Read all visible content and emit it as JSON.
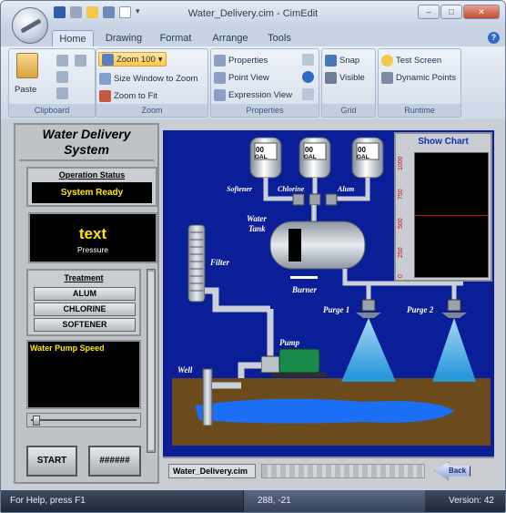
{
  "window": {
    "title": "Water_Delivery.cim - CimEdit",
    "min": "–",
    "max": "□",
    "close": "✕"
  },
  "tabs": [
    "Home",
    "Drawing",
    "Format",
    "Arrange",
    "Tools"
  ],
  "ribbon": {
    "clipboard": {
      "label": "Clipboard",
      "paste": "Paste"
    },
    "zoom": {
      "label": "Zoom",
      "zoom100": "Zoom 100",
      "size_window": "Size Window to Zoom",
      "zoom_fit": "Zoom to Fit"
    },
    "properties": {
      "label": "Properties",
      "properties": "Properties",
      "point_view": "Point View",
      "expression_view": "Expression View"
    },
    "grid": {
      "label": "Grid",
      "snap": "Snap",
      "visible": "Visible"
    },
    "runtime": {
      "label": "Runtime",
      "test_screen": "Test Screen",
      "dynamic_points": "Dynamic Points"
    }
  },
  "panel": {
    "title_line1": "Water Delivery",
    "title_line2": "System",
    "op_status_label": "Operation Status",
    "op_status_value": "System Ready",
    "pressure_value": "text",
    "pressure_label": "Pressure",
    "treatment_label": "Treatment",
    "treatments": [
      "ALUM",
      "CHLORINE",
      "SOFTENER"
    ],
    "pump_speed_label": "Water Pump Speed",
    "start": "START",
    "hash": "######"
  },
  "scene": {
    "tanks": [
      {
        "value": "00",
        "unit": "GAL",
        "label": "Softener"
      },
      {
        "value": "00",
        "unit": "GAL",
        "label": "Chlorine"
      },
      {
        "value": "00",
        "unit": "GAL",
        "label": "Alum"
      }
    ],
    "water_tank": "Water\nTank",
    "filter": "Filter",
    "burner": "Burner",
    "pump": "Pump",
    "well": "Well",
    "purge1": "Purge 1",
    "purge2": "Purge 2",
    "show_chart": "Show Chart",
    "chart_ticks": [
      "1000",
      "750",
      "500",
      "250",
      "0"
    ],
    "footer_file": "Water_Delivery.cim",
    "back": "Back"
  },
  "status": {
    "help": "For Help, press F1",
    "coords": "288, -21",
    "version": "Version: 42"
  }
}
